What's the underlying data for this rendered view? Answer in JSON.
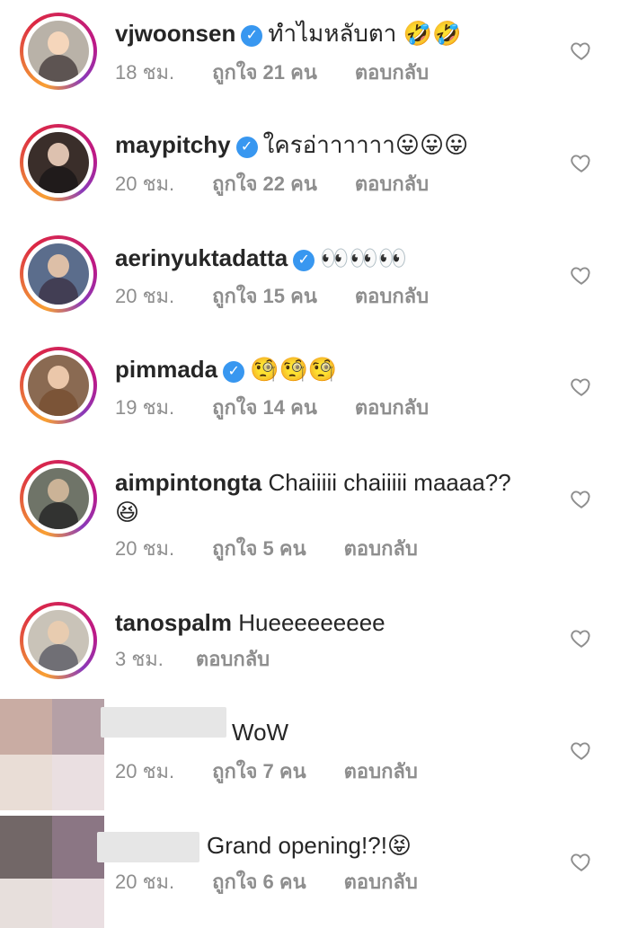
{
  "comments": [
    {
      "username": "vjwoonsen",
      "verified": true,
      "text": "ทำไมหลับตา 🤣🤣",
      "time": "18 ชม.",
      "likes": "ถูกใจ 21 คน",
      "reply": "ตอบกลับ"
    },
    {
      "username": "maypitchy",
      "verified": true,
      "text": "ใครอ่าาาาาา😛😛😛",
      "time": "20 ชม.",
      "likes": "ถูกใจ 22 คน",
      "reply": "ตอบกลับ"
    },
    {
      "username": "aerinyuktadatta",
      "verified": true,
      "text": "👀👀👀",
      "time": "20 ชม.",
      "likes": "ถูกใจ 15 คน",
      "reply": "ตอบกลับ"
    },
    {
      "username": "pimmada",
      "verified": true,
      "text": "🧐🧐🧐",
      "time": "19 ชม.",
      "likes": "ถูกใจ 14 คน",
      "reply": "ตอบกลับ"
    },
    {
      "username": "aimpintongta",
      "verified": false,
      "text": "Chaiiiii chaiiiii maaaa??",
      "text2": "😆",
      "time": "20 ชม.",
      "likes": "ถูกใจ 5 คน",
      "reply": "ตอบกลับ"
    },
    {
      "username": "tanospalm",
      "verified": false,
      "text": "Hueeeeeeeee",
      "time": "3 ชม.",
      "reply": "ตอบกลับ"
    },
    {
      "text": "WoW",
      "time": "20 ชม.",
      "likes": "ถูกใจ 7 คน",
      "reply": "ตอบกลับ"
    },
    {
      "text": "Grand opening!?!😝",
      "time": "20 ชม.",
      "likes": "ถูกใจ 6 คน",
      "reply": "ตอบกลับ"
    }
  ],
  "icons": {
    "heart": "heart-outline-icon",
    "verified": "verified-badge-icon"
  },
  "colors": {
    "verified": "#3897f0",
    "meta": "#8e8e8e",
    "text": "#262626"
  }
}
